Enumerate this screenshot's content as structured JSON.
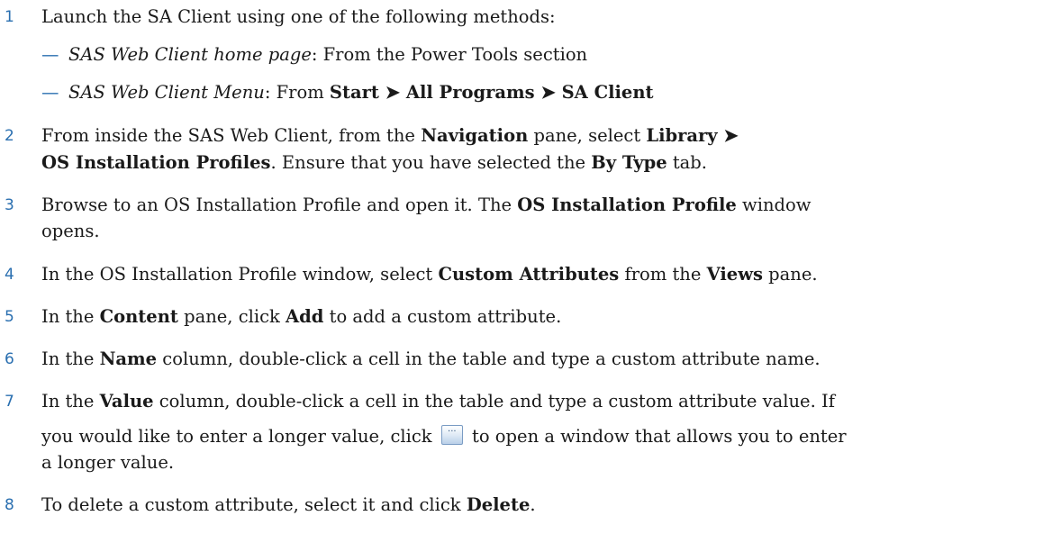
{
  "steps": [
    {
      "num": "1",
      "text": "Launch the SA Client using one of the following methods:",
      "sub": [
        {
          "dash": "—",
          "italic": "SAS Web Client home page",
          "rest": ": From the Power Tools section"
        },
        {
          "dash": "—",
          "italic": "SAS Web Client Menu",
          "rest1": ": From ",
          "b1": "Start",
          "arrow1": " ➤ ",
          "b2": "All Programs",
          "arrow2": " ➤ ",
          "b3": "SA Client"
        }
      ]
    },
    {
      "num": "2",
      "l1a": "From inside the SAS Web Client, from the ",
      "l1b": "Navigation",
      "l1c": " pane, select ",
      "l1d": "Library ➤",
      "l2a": "OS Installation Profiles",
      "l2b": ". Ensure that you have selected the ",
      "l2c": "By Type",
      "l2d": " tab."
    },
    {
      "num": "3",
      "l1a": "Browse to an OS Installation Profile and open it. The ",
      "l1b": "OS Installation Profile",
      "l1c": " window",
      "l2a": "opens."
    },
    {
      "num": "4",
      "a": "In the OS Installation Profile window, select ",
      "b": "Custom Attributes",
      "c": " from the ",
      "d": "Views",
      "e": " pane."
    },
    {
      "num": "5",
      "a": "In the ",
      "b": "Content",
      "c": " pane, click ",
      "d": "Add",
      "e": " to add a custom attribute."
    },
    {
      "num": "6",
      "a": "In the ",
      "b": "Name",
      "c": " column, double-click a cell in the table and type a custom attribute name."
    },
    {
      "num": "7",
      "l1a": "In the ",
      "l1b": "Value",
      "l1c": " column, double-click a cell in the table and type a custom attribute value. If",
      "l2a": "you would like to enter a longer value, click ",
      "l2b": " to open a window that allows you to enter",
      "l3a": "a longer value.",
      "icon": "ellipsis-button-icon"
    },
    {
      "num": "8",
      "a": "To delete a custom attribute, select it and click ",
      "b": "Delete",
      "c": "."
    }
  ]
}
